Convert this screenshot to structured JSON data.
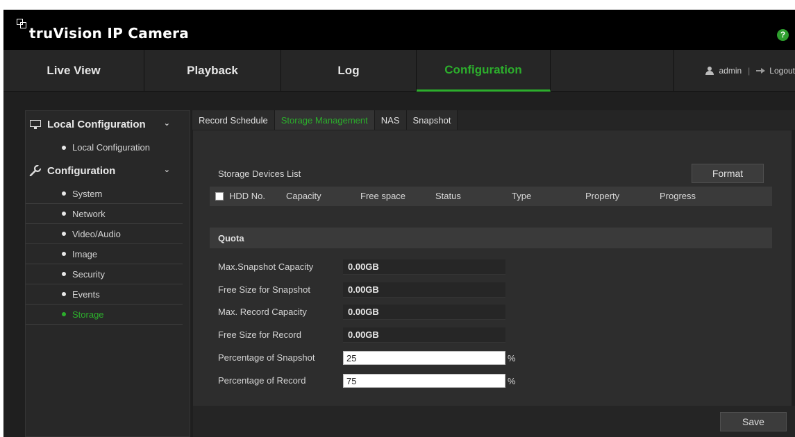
{
  "header": {
    "logo_text": "truVision IP Camera",
    "help_label": "?"
  },
  "nav": {
    "tabs": [
      {
        "label": "Live View"
      },
      {
        "label": "Playback"
      },
      {
        "label": "Log"
      },
      {
        "label": "Configuration",
        "active": true
      }
    ],
    "user": "admin",
    "separator": "|",
    "logout": "Logout"
  },
  "sidebar": {
    "groups": [
      {
        "label": "Local Configuration",
        "icon": "monitor-icon",
        "items": [
          "Local Configuration"
        ]
      },
      {
        "label": "Configuration",
        "icon": "wrench-icon",
        "items": [
          "System",
          "Network",
          "Video/Audio",
          "Image",
          "Security",
          "Events",
          "Storage"
        ]
      }
    ],
    "active_item": "Storage"
  },
  "subtabs": [
    {
      "label": "Record Schedule"
    },
    {
      "label": "Storage Management",
      "active": true
    },
    {
      "label": "NAS"
    },
    {
      "label": "Snapshot"
    }
  ],
  "storage": {
    "title": "Storage Devices List",
    "format_label": "Format",
    "columns": [
      "HDD No.",
      "Capacity",
      "Free space",
      "Status",
      "Type",
      "Property",
      "Progress"
    ]
  },
  "quota": {
    "title": "Quota",
    "rows": [
      {
        "label": "Max.Snapshot Capacity",
        "value": "0.00GB"
      },
      {
        "label": "Free Size for Snapshot",
        "value": "0.00GB"
      },
      {
        "label": "Max. Record Capacity",
        "value": "0.00GB"
      },
      {
        "label": "Free Size for Record",
        "value": "0.00GB"
      }
    ],
    "percent_rows": [
      {
        "label": "Percentage of Snapshot",
        "value": "25",
        "unit": "%"
      },
      {
        "label": "Percentage of Record",
        "value": "75",
        "unit": "%"
      }
    ]
  },
  "footer": {
    "save_label": "Save"
  },
  "colors": {
    "accent": "#2cae2c",
    "background": "#1f1f1f"
  }
}
